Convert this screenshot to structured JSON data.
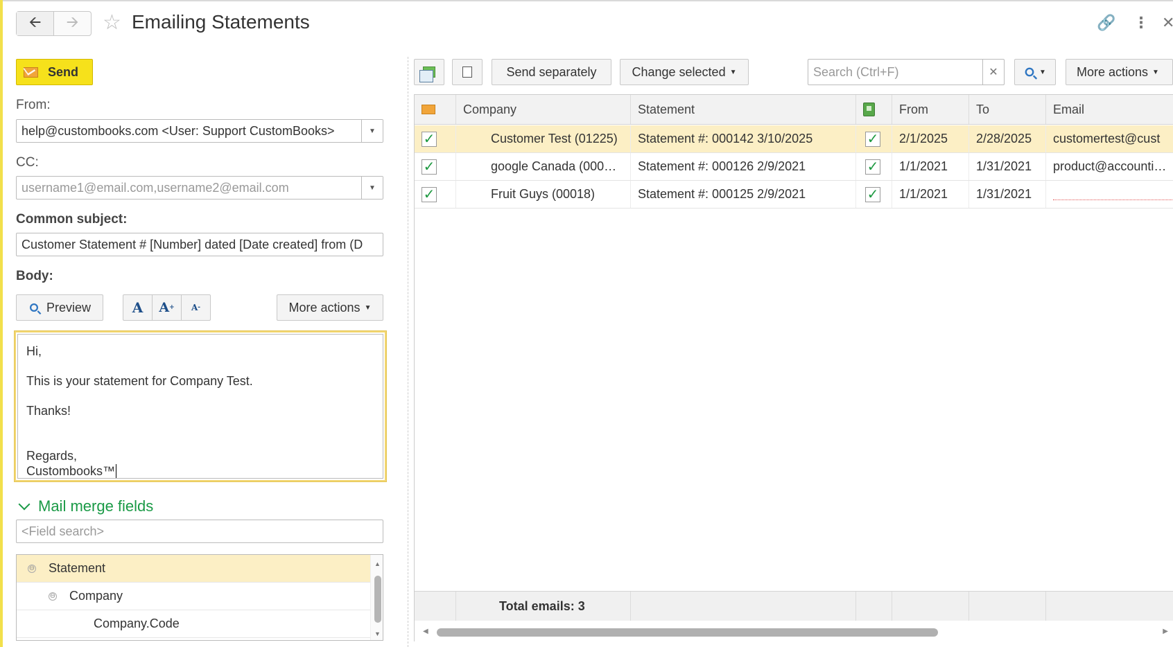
{
  "window": {
    "title": "Emailing Statements"
  },
  "left": {
    "send_label": "Send",
    "from_label": "From:",
    "from_value": "help@custombooks.com <User: Support CustomBooks>",
    "cc_label": "CC:",
    "cc_placeholder": "username1@email.com,username2@email.com",
    "subject_label": "Common subject:",
    "subject_value": "Customer Statement # [Number] dated [Date created] from (D",
    "body_label": "Body:",
    "preview_label": "Preview",
    "more_actions_label": "More actions",
    "body_lines": [
      "Hi,",
      "This is your statement for Company Test.",
      "Thanks!",
      "Regards,",
      "Custombooks™"
    ],
    "mail_merge_label": "Mail merge fields",
    "field_search_placeholder": "<Field search>",
    "tree": [
      {
        "label": "Statement",
        "expander": "⊖"
      },
      {
        "label": "Company",
        "expander": "⊖"
      },
      {
        "label": "Company.Code",
        "expander": ""
      }
    ]
  },
  "right": {
    "send_separately_label": "Send separately",
    "change_selected_label": "Change selected",
    "search_placeholder": "Search (Ctrl+F)",
    "more_actions_label": "More actions",
    "columns": [
      "Company",
      "Statement",
      "From",
      "To",
      "Email"
    ],
    "rows": [
      {
        "checked": true,
        "company": "Customer Test (01225)",
        "statement": "Statement #: 000142 3/10/2025",
        "attach": true,
        "from": "2/1/2025",
        "to": "2/28/2025",
        "email": "customertest@cust"
      },
      {
        "checked": true,
        "company": "google Canada (000…",
        "statement": "Statement #: 000126 2/9/2021",
        "attach": true,
        "from": "1/1/2021",
        "to": "1/31/2021",
        "email": "product@accounti…"
      },
      {
        "checked": true,
        "company": "Fruit Guys (00018)",
        "statement": "Statement #: 000125 2/9/2021",
        "attach": true,
        "from": "1/1/2021",
        "to": "1/31/2021",
        "email": ""
      }
    ],
    "footer_total": "Total emails: 3"
  },
  "colors": {
    "accent_yellow": "#f6e11b",
    "selected_row": "#fcefc5",
    "merge_green": "#1a9a46",
    "check_green": "#1d9940"
  }
}
